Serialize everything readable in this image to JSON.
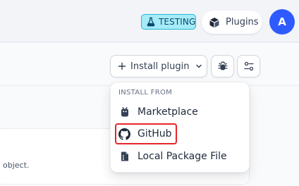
{
  "header": {
    "badge_label": "TESTING",
    "plugins_label": "Plugins",
    "avatar_initial": "A"
  },
  "toolbar": {
    "install_label": "Install plugin"
  },
  "dropdown": {
    "header": "INSTALL FROM",
    "items": [
      {
        "label": "Marketplace",
        "icon": "marketplace-icon"
      },
      {
        "label": "GitHub",
        "icon": "github-icon",
        "highlighted": true
      },
      {
        "label": "Local Package File",
        "icon": "package-file-icon"
      }
    ]
  },
  "card": {
    "text": "object."
  },
  "colors": {
    "badge_bg": "#a5ecf8",
    "avatar_bg": "#2e5bff",
    "highlight_border": "#e5252a"
  }
}
